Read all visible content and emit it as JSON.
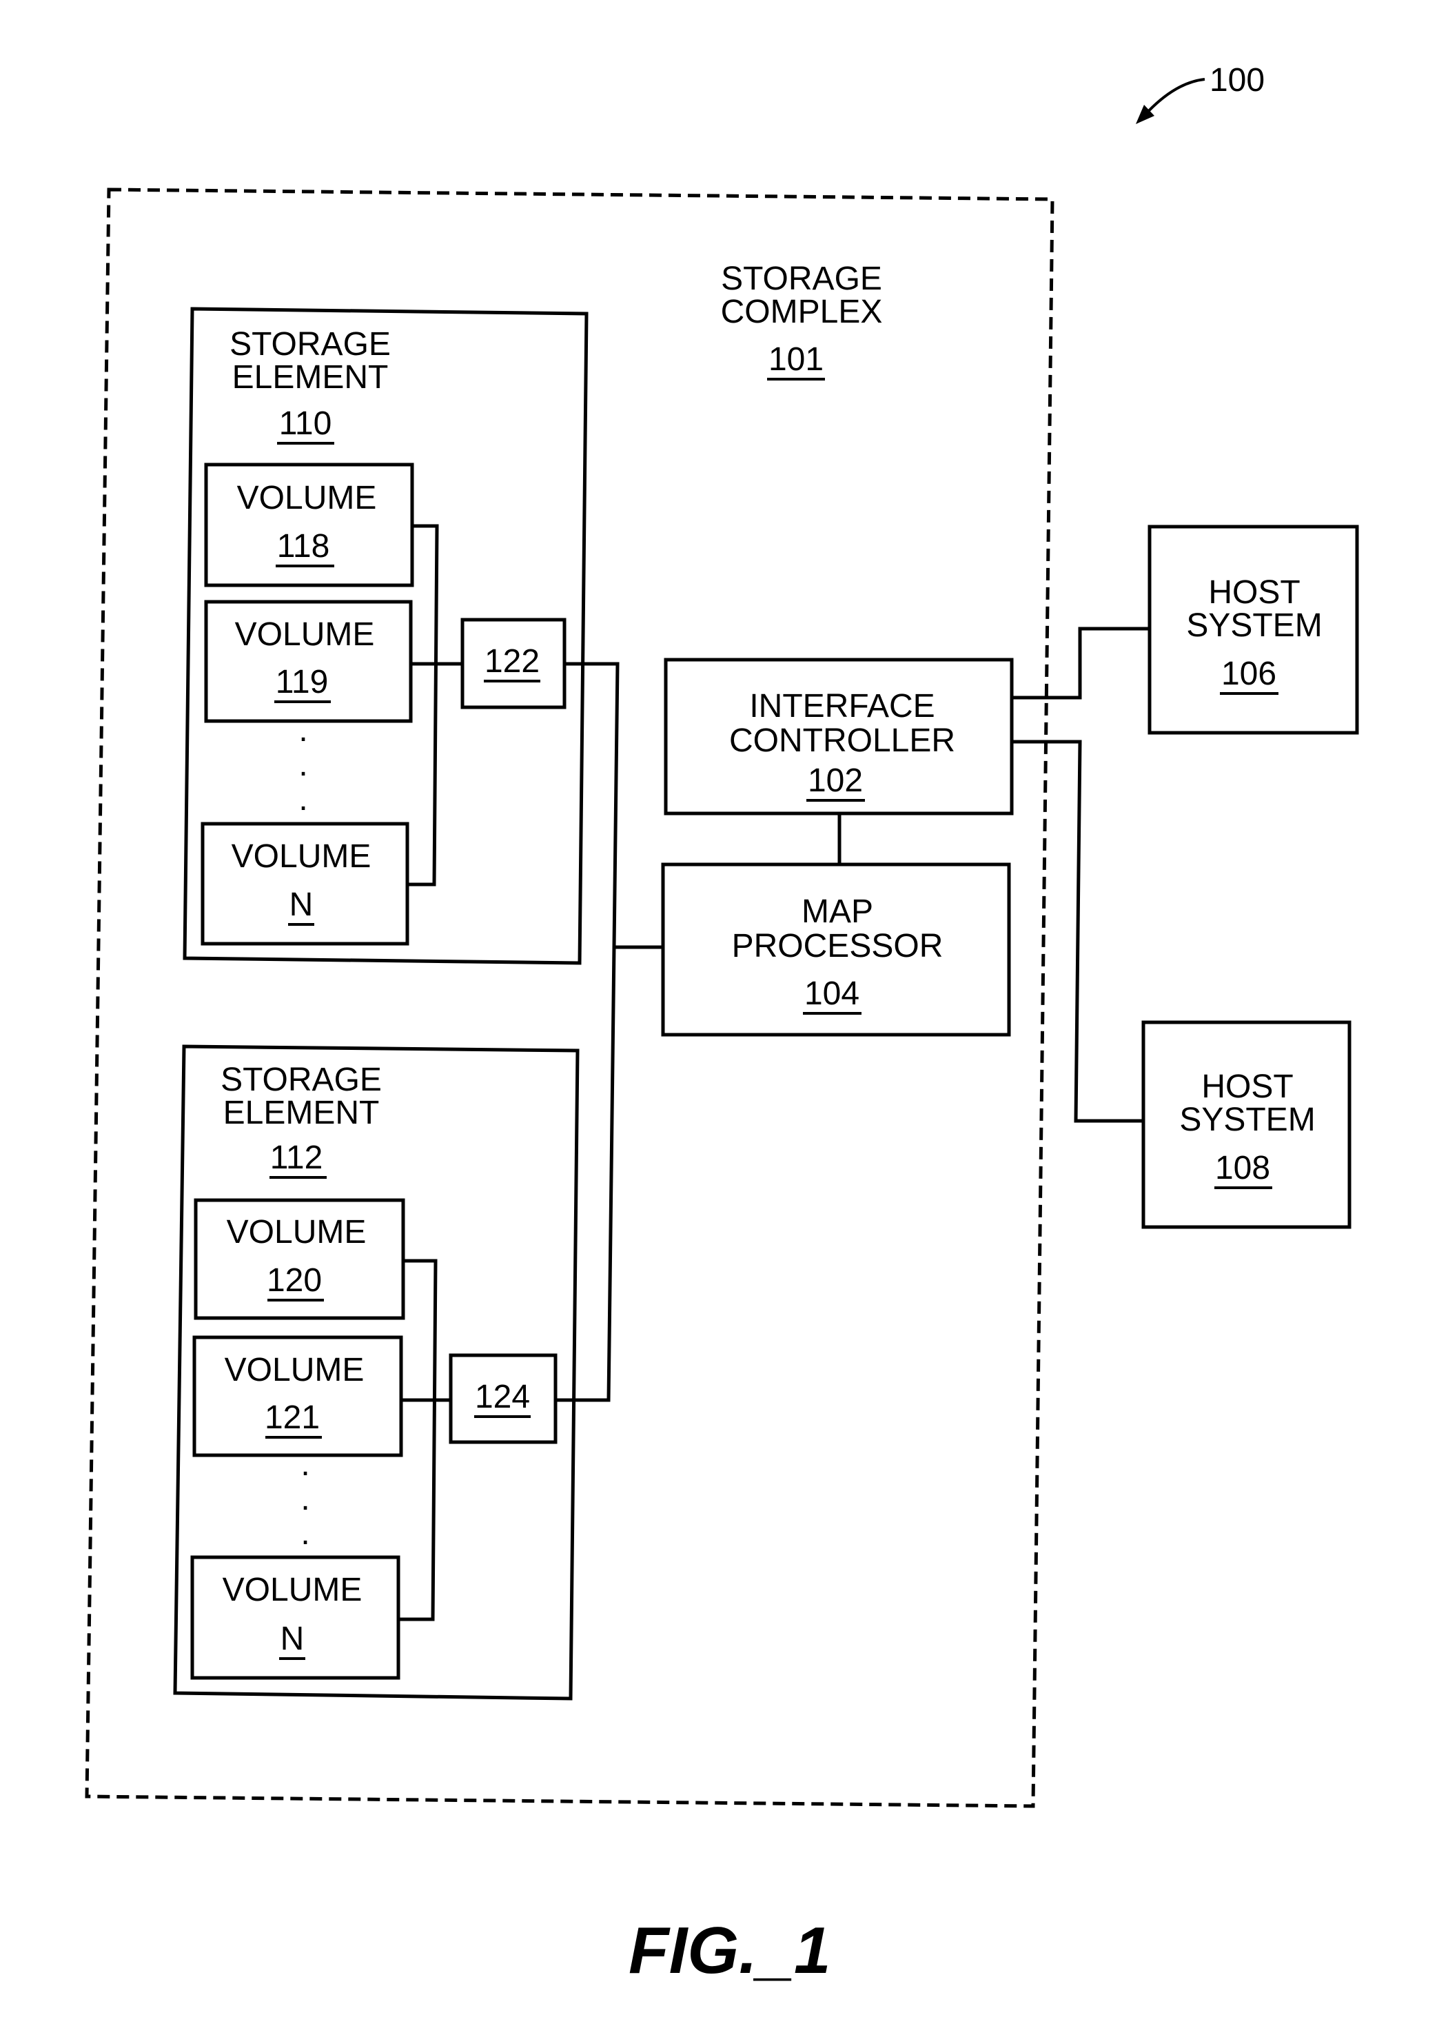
{
  "figure": {
    "reference": "100",
    "caption": "FIG._1"
  },
  "storage_complex": {
    "line1": "STORAGE",
    "line2": "COMPLEX",
    "ref": "101"
  },
  "storage_elements": [
    {
      "line1": "STORAGE",
      "line2": "ELEMENT",
      "ref": "110",
      "volumes": [
        {
          "label": "VOLUME",
          "ref": "118"
        },
        {
          "label": "VOLUME",
          "ref": "119"
        },
        {
          "label": "VOLUME",
          "ref": "N"
        }
      ],
      "connector_ref": "122"
    },
    {
      "line1": "STORAGE",
      "line2": "ELEMENT",
      "ref": "112",
      "volumes": [
        {
          "label": "VOLUME",
          "ref": "120"
        },
        {
          "label": "VOLUME",
          "ref": "121"
        },
        {
          "label": "VOLUME",
          "ref": "N"
        }
      ],
      "connector_ref": "124"
    }
  ],
  "interface_controller": {
    "line1": "INTERFACE",
    "line2": "CONTROLLER",
    "ref": "102"
  },
  "map_processor": {
    "line1": "MAP",
    "line2": "PROCESSOR",
    "ref": "104"
  },
  "hosts": [
    {
      "line1": "HOST",
      "line2": "SYSTEM",
      "ref": "106"
    },
    {
      "line1": "HOST",
      "line2": "SYSTEM",
      "ref": "108"
    }
  ],
  "ellipsis": "."
}
